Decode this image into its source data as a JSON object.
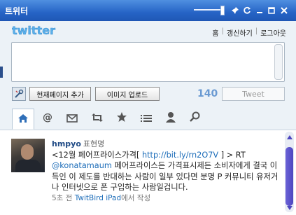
{
  "window": {
    "title": "트위터"
  },
  "header": {
    "logo": "twitter",
    "nav": [
      "홈",
      "갱신하기",
      "로그아웃"
    ]
  },
  "composer": {
    "buttons": [
      "현재페이지 추가",
      "이미지 업로드"
    ],
    "char_count": "140",
    "tweet_button": "Tweet"
  },
  "tabs": [
    {
      "name": "home-icon",
      "active": true
    },
    {
      "name": "mention-icon"
    },
    {
      "name": "message-icon"
    },
    {
      "name": "retweet-icon"
    },
    {
      "name": "star-icon"
    },
    {
      "name": "list-icon"
    },
    {
      "name": "user-icon"
    },
    {
      "name": "search-icon"
    }
  ],
  "timeline": {
    "tweets": [
      {
        "username": "hmpyo",
        "realname": "표현명",
        "text_before_link": "<12월 페어프라이스가격[ ",
        "link": "http://bit.ly/rn2O7V",
        "text_after_link": " ] > RT",
        "mention": "@konatamaum",
        "text_body": " 페어프라이스든 가격표시제든 소비자에게 결국 이득인 이 제도를 반대하는 사람이 일부 있다면 분명 P 커뮤니티 유저거나 인터넷으로 폰 구입하는 사람일겁니다.",
        "time": "5초 전",
        "source": "TwitBird iPad",
        "source_suffix": "에서 작성"
      }
    ]
  },
  "colors": {
    "title_bar": "#2664c6",
    "accent": "#1d6db9",
    "scroll_thumb": "#4d46bf"
  }
}
